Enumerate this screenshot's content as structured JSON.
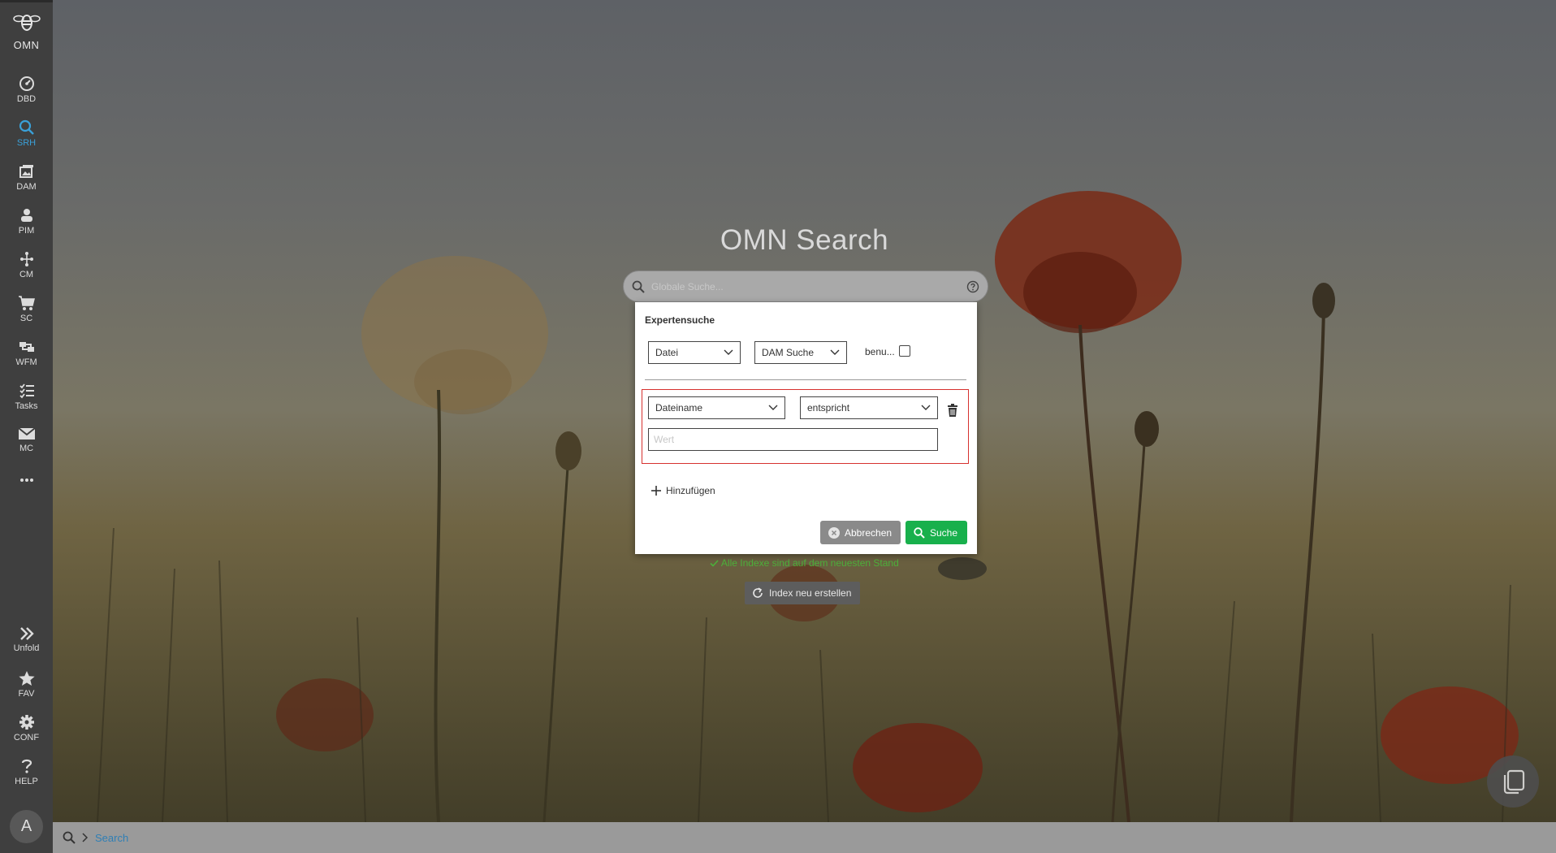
{
  "app": {
    "logo_text": "OMN",
    "title": "OMN Search"
  },
  "nav": {
    "items": [
      {
        "label": "DBD",
        "icon": "dashboard-icon"
      },
      {
        "label": "SRH",
        "icon": "search-icon",
        "active": true
      },
      {
        "label": "DAM",
        "icon": "images-icon"
      },
      {
        "label": "PIM",
        "icon": "product-icon"
      },
      {
        "label": "CM",
        "icon": "network-icon"
      },
      {
        "label": "SC",
        "icon": "cart-icon"
      },
      {
        "label": "WFM",
        "icon": "workflow-icon"
      },
      {
        "label": "Tasks",
        "icon": "tasks-icon"
      },
      {
        "label": "MC",
        "icon": "mail-icon"
      }
    ],
    "bottom": [
      {
        "label": "Unfold",
        "icon": "unfold-icon"
      },
      {
        "label": "FAV",
        "icon": "star-icon"
      },
      {
        "label": "CONF",
        "icon": "gear-icon"
      },
      {
        "label": "HELP",
        "icon": "help-icon"
      }
    ],
    "avatar": "A"
  },
  "search": {
    "placeholder": "Globale Suche..."
  },
  "expert": {
    "title": "Expertensuche",
    "type_value": "Datei",
    "scope_value": "DAM Suche",
    "checkbox_label": "benu...",
    "field_value": "Dateiname",
    "operator_value": "entspricht",
    "value_placeholder": "Wert",
    "add_label": "Hinzufügen",
    "cancel_label": "Abbrechen",
    "search_label": "Suche"
  },
  "status_text": "Alle Indexe sind auf dem neuesten Stand",
  "reindex_label": "Index neu erstellen",
  "breadcrumb": {
    "current": "Search"
  },
  "colors": {
    "accent": "#3aa0d8",
    "success": "#18b04c",
    "error_border": "#d6312f"
  }
}
